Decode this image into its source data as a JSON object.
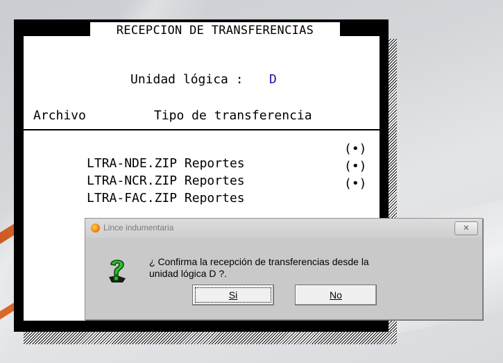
{
  "panel": {
    "title": "RECEPCION DE TRANSFERENCIAS",
    "unidad_label": "Unidad lógica :",
    "unidad_value": "D",
    "col_archivo": "Archivo",
    "col_tipo": "Tipo de transferencia",
    "rows": [
      {
        "file": "LTRA-NDE.ZIP",
        "type": "Reportes",
        "radio": "(•)"
      },
      {
        "file": "LTRA-NCR.ZIP",
        "type": "Reportes",
        "radio": "(•)"
      },
      {
        "file": "LTRA-FAC.ZIP",
        "type": "Reportes",
        "radio": "(•)"
      }
    ]
  },
  "dialog": {
    "title": "Lince indumentaria",
    "close_label": "✕",
    "message_line1": "¿ Confirma la recepción de transferencias desde la",
    "message_line2": "unidad lógica D ?.",
    "yes_label": "Si",
    "no_label": "No",
    "icon": "question-icon",
    "app_icon": "lince-app-icon"
  }
}
